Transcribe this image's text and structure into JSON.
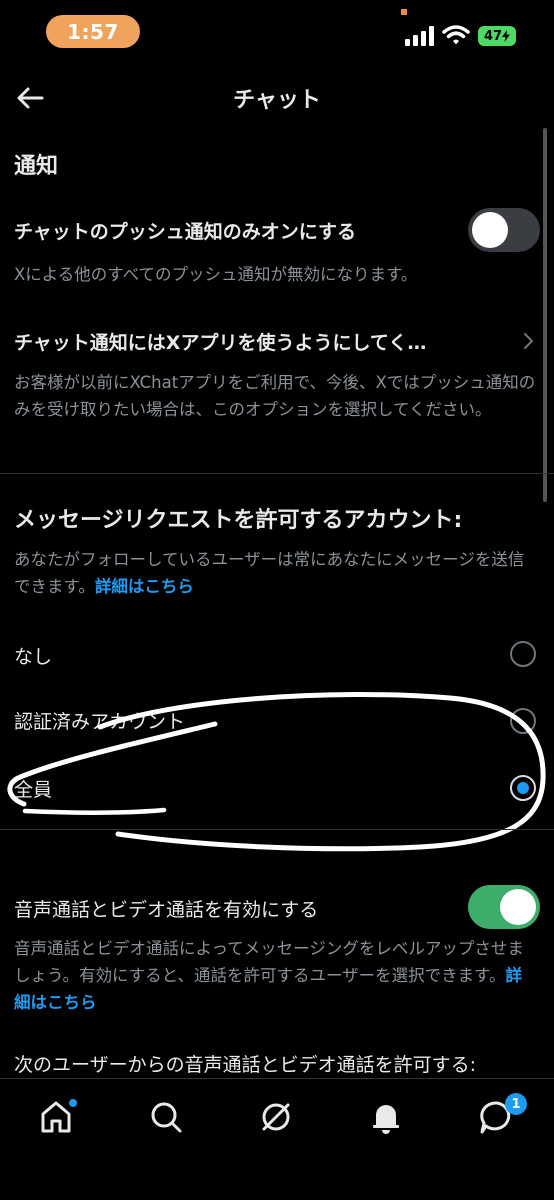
{
  "status_bar": {
    "time": "1:57",
    "battery": "47"
  },
  "header": {
    "title": "チャット"
  },
  "notifications": {
    "section_title": "通知",
    "push_only": {
      "label": "チャットのプッシュ通知のみオンにする",
      "description": "Xによる他のすべてのプッシュ通知が無効になります。",
      "enabled": false
    },
    "xchat_app": {
      "label": "チャット通知にはXアプリを使うようにしてく…",
      "description": "お客様が以前にXChatアプリをご利用で、今後、Xではプッシュ通知のみを受け取りたい場合は、このオプションを選択してください。"
    }
  },
  "message_requests": {
    "section_title": "メッセージリクエストを許可するアカウント:",
    "description": "あなたがフォローしているユーザーは常にあなたにメッセージを送信できます。",
    "link": "詳細はこちら",
    "options": [
      {
        "label": "なし",
        "selected": false
      },
      {
        "label": "認証済みアカウント",
        "selected": false
      },
      {
        "label": "全員",
        "selected": true
      }
    ]
  },
  "calls": {
    "label": "音声通話とビデオ通話を有効にする",
    "enabled": true,
    "description": "音声通話とビデオ通話によってメッセージングをレベルアップさせましょう。有効にすると、通話を許可するユーザーを選択できます。",
    "link": "詳細はこちら",
    "allow_title": "次のユーザーからの音声通話とビデオ通話を許可する:"
  },
  "bottom_nav": {
    "chat_badge": "1"
  },
  "colors": {
    "accent": "#1d9bf0",
    "toggle_on": "#3ead6b",
    "time_pill": "#f0a35c"
  }
}
